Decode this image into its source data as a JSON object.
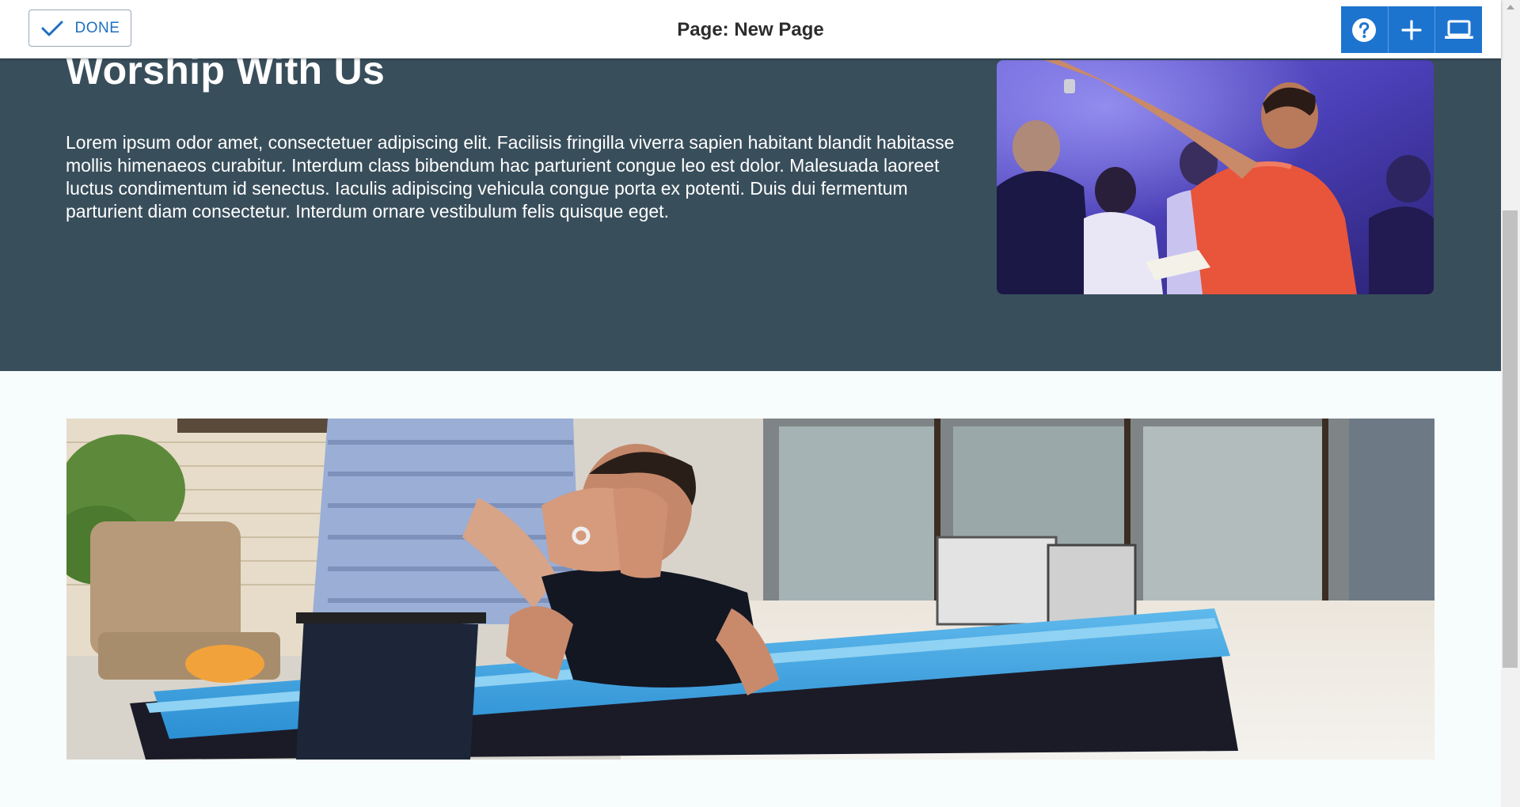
{
  "toolbar": {
    "done_label": "DONE",
    "page_title": "Page: New Page",
    "icons": [
      "check-icon",
      "help-icon",
      "plus-icon",
      "laptop-icon"
    ],
    "accent_color": "#1d74cf"
  },
  "worship_section": {
    "title": "Worship With Us",
    "body": "Lorem ipsum odor amet, consectetuer adipiscing elit. Facilisis fringilla viverra sapien habitant blandit habitasse mollis himenaeos curabitur. Interdum class bibendum hac parturient congue leo est dolor. Malesuada laoreet luctus condimentum id senectus. Iaculis adipiscing vehicula congue porta ex potenti. Duis dui fermentum parturient diam consectetur. Interdum ornare vestibulum felis quisque eget.",
    "background_color": "#394e5b"
  }
}
